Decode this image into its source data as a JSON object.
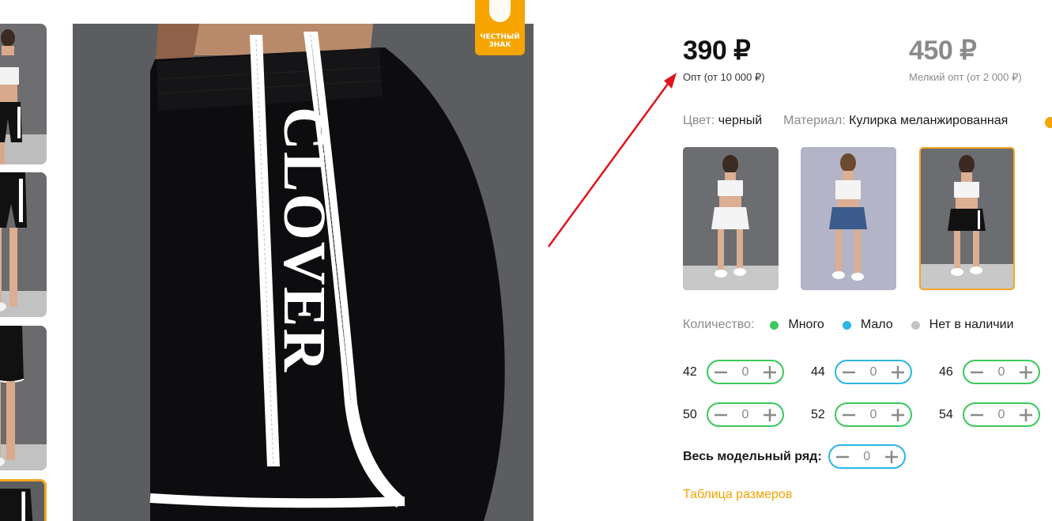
{
  "product": {
    "badge_line1": "ЧЕСТНЫЙ",
    "badge_line2": "ЗНАК",
    "print_text": "CLOVER"
  },
  "prices": {
    "main_value": "390 ₽",
    "main_caption": "Опт (от 10 000 ₽)",
    "small_value": "450 ₽",
    "small_caption": "Мелкий опт (от 2 000 ₽)"
  },
  "attributes": {
    "color_label": "Цвет:",
    "color_value": "черный",
    "material_label": "Материал:",
    "material_value": "Кулирка меланжированная"
  },
  "availability": {
    "label": "Количество:",
    "items": [
      {
        "text": "Много",
        "color": "#3cc85a"
      },
      {
        "text": "Мало",
        "color": "#2bb5e6"
      },
      {
        "text": "Нет в наличии",
        "color": "#c4c4c4"
      }
    ]
  },
  "sizes": [
    {
      "size": "42",
      "qty": "0",
      "stock_color": "#3cc85a"
    },
    {
      "size": "44",
      "qty": "0",
      "stock_color": "#2bb5e6"
    },
    {
      "size": "46",
      "qty": "0",
      "stock_color": "#3cc85a"
    },
    {
      "size": "50",
      "qty": "0",
      "stock_color": "#3cc85a"
    },
    {
      "size": "52",
      "qty": "0",
      "stock_color": "#3cc85a"
    },
    {
      "size": "54",
      "qty": "0",
      "stock_color": "#3cc85a"
    }
  ],
  "whole_range": {
    "label": "Весь модельный ряд:",
    "qty": "0"
  },
  "size_table_link": "Таблица размеров",
  "colors": {
    "accent": "#f5a400",
    "annotation_arrow": "#e0141e"
  }
}
